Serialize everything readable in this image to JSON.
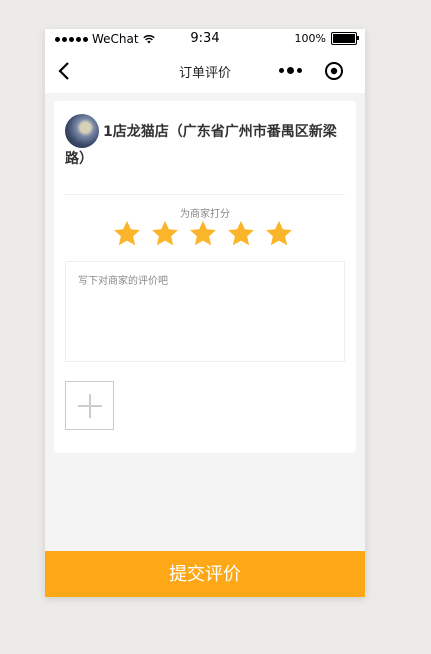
{
  "status_bar": {
    "carrier": "WeChat",
    "time": "9:34",
    "battery": "100%",
    "signal_icon": "signal-dots-icon",
    "wifi_icon": "wifi-icon",
    "battery_icon": "battery-icon"
  },
  "nav": {
    "title": "订单评价",
    "back_icon": "chevron-left-icon",
    "more_icon": "more-dots-icon",
    "close_icon": "target-circle-icon"
  },
  "shop": {
    "name": "1店龙猫店（广东省广州市番禺区新梁路）",
    "avatar": "shop-avatar"
  },
  "rating": {
    "label": "为商家打分",
    "value": 5,
    "max": 5,
    "star_color": "#fbb52a"
  },
  "review": {
    "placeholder": "写下对商家的评价吧",
    "value": ""
  },
  "photo": {
    "add_icon": "plus-icon"
  },
  "submit": {
    "label": "提交评价",
    "color": "#fea817"
  }
}
